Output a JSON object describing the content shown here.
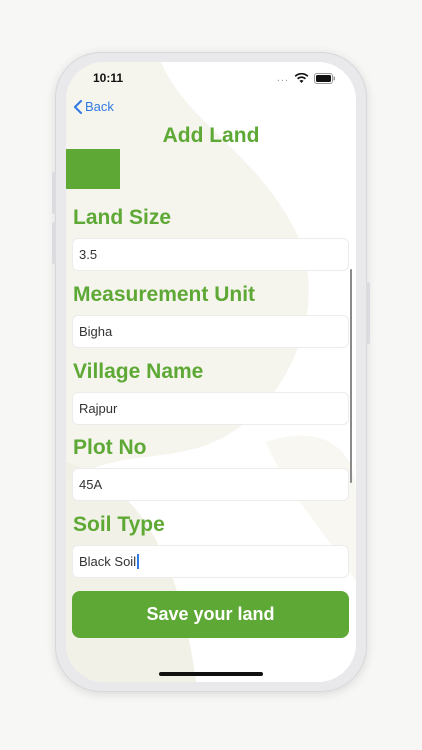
{
  "status_bar": {
    "time": "10:11",
    "signal_dots": "..."
  },
  "nav": {
    "back_label": "Back",
    "title": "Add Land"
  },
  "form": {
    "fields": [
      {
        "label": "Land Size",
        "value": "3.5"
      },
      {
        "label": "Measurement Unit",
        "value": "Bigha"
      },
      {
        "label": "Village Name",
        "value": "Rajpur"
      },
      {
        "label": "Plot No",
        "value": "45A"
      },
      {
        "label": "Soil Type",
        "value": "Black Soil"
      }
    ],
    "save_label": "Save your land"
  },
  "colors": {
    "accent": "#5ea935",
    "link": "#2f7ae5",
    "background": "#f7f7f5"
  },
  "icons": [
    "back-chevron-icon",
    "wifi-icon",
    "battery-icon",
    "signal-icon"
  ]
}
